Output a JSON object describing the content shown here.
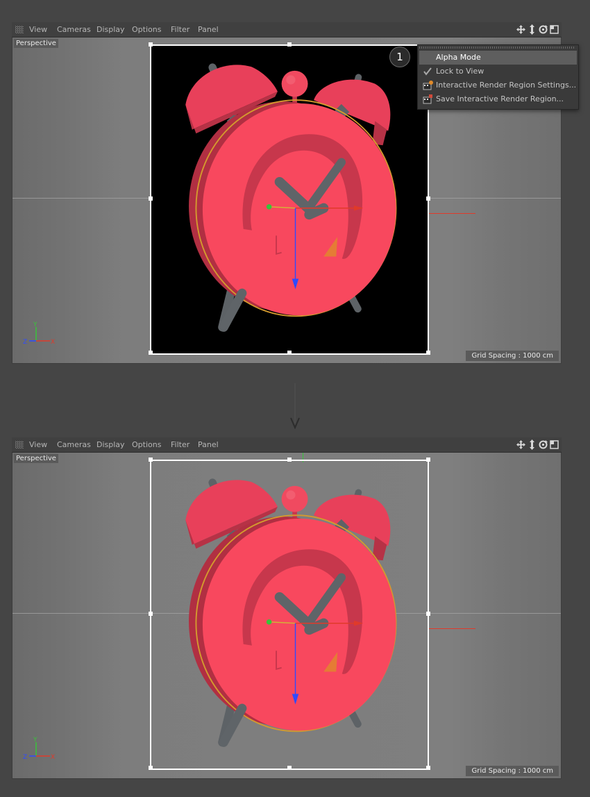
{
  "menu": {
    "items": [
      "View",
      "Cameras",
      "Display",
      "Options",
      "Filter",
      "Panel"
    ],
    "toolbar_icons": [
      "move-icon",
      "zoom-icon",
      "rotate-icon",
      "maximize-icon"
    ]
  },
  "viewport_top": {
    "camera_label": "Perspective",
    "grid_spacing": "Grid Spacing : 1000 cm",
    "render_background": "#000000"
  },
  "viewport_bottom": {
    "camera_label": "Perspective",
    "grid_spacing": "Grid Spacing : 1000 cm",
    "render_background": "transparent"
  },
  "dropdown": {
    "items": [
      {
        "label": "Alpha Mode",
        "icon": "none",
        "highlighted": true
      },
      {
        "label": "Lock to View",
        "icon": "checkmark-icon",
        "checked": true
      },
      {
        "label": "Interactive Render Region Settings...",
        "icon": "render-settings-icon"
      },
      {
        "label": "Save Interactive Render Region...",
        "icon": "render-save-icon"
      }
    ]
  },
  "callout": {
    "number": "1"
  },
  "axis_labels": {
    "y": "Y",
    "z": "Z",
    "x": "X"
  },
  "colors": {
    "clock_red": "#f8485e",
    "clock_dark_red": "#c7374c",
    "metal_gray": "#5f6468",
    "axis_x": "#e03a2a",
    "axis_y": "#38c43a",
    "axis_z": "#2f4bff"
  }
}
